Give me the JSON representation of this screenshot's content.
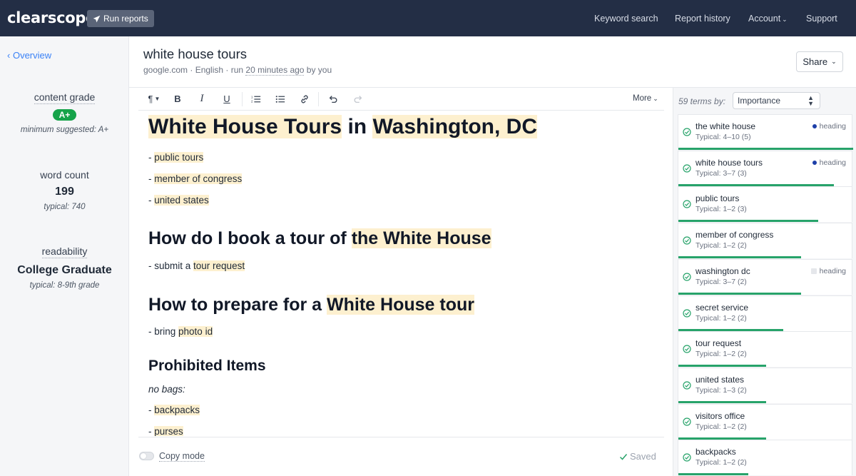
{
  "topbar": {
    "logo": "clearscope",
    "run_reports": "Run reports",
    "nav": {
      "keyword_search": "Keyword search",
      "report_history": "Report history",
      "account": "Account",
      "support": "Support"
    }
  },
  "sidebar": {
    "overview": "Overview",
    "content_grade_label": "content grade",
    "content_grade": "A+",
    "grade_min": "minimum suggested: A+",
    "word_count_label": "word count",
    "word_count": "199",
    "word_typical": "typical: 740",
    "readability_label": "readability",
    "readability": "College Graduate",
    "readability_typical": "typical: 8-9th grade"
  },
  "header": {
    "title": "white house tours",
    "meta_prefix": "google.com · English · run ",
    "meta_ago": "20 minutes ago",
    "meta_suffix": " by you",
    "share": "Share"
  },
  "toolbar": {
    "more": "More"
  },
  "document": {
    "h1_a": "White House Tours",
    "h1_b": " in ",
    "h1_c": "Washington, DC",
    "li1_prefix": "- ",
    "li1": "public tours",
    "li2_prefix": "- ",
    "li2": "member of congress",
    "li3_prefix": "- ",
    "li3": "united states",
    "h2a_a": "How do I book a tour of ",
    "h2a_b": "the White House",
    "p1_a": "- submit a ",
    "p1_b": "tour request",
    "h2b_a": "How to prepare for a ",
    "h2b_b": "White House tour",
    "p2_a": "- bring ",
    "p2_b": "photo id",
    "h3": "Prohibited Items",
    "p3": "no bags:",
    "li4_prefix": "- ",
    "li4": "backpacks",
    "li5_prefix": "- ",
    "li5": "purses"
  },
  "footer": {
    "copy_mode": "Copy mode",
    "saved": "Saved"
  },
  "terms_panel": {
    "count_label": "59 terms by:",
    "sort_value": "Importance",
    "terms": [
      {
        "name": "the white house",
        "typical": "Typical: 4–10 (5)",
        "tag": "heading",
        "tag_style": "dot",
        "progress": 1.0
      },
      {
        "name": "white house tours",
        "typical": "Typical: 3–7 (3)",
        "tag": "heading",
        "tag_style": "dot",
        "progress": 0.89
      },
      {
        "name": "public tours",
        "typical": "Typical: 1–2 (3)",
        "tag": "",
        "tag_style": "",
        "progress": 0.8
      },
      {
        "name": "member of congress",
        "typical": "Typical: 1–2 (2)",
        "tag": "",
        "tag_style": "",
        "progress": 0.7
      },
      {
        "name": "washington dc",
        "typical": "Typical: 3–7 (2)",
        "tag": "heading",
        "tag_style": "square",
        "progress": 0.7
      },
      {
        "name": "secret service",
        "typical": "Typical: 1–2 (2)",
        "tag": "",
        "tag_style": "",
        "progress": 0.6
      },
      {
        "name": "tour request",
        "typical": "Typical: 1–2 (2)",
        "tag": "",
        "tag_style": "",
        "progress": 0.5
      },
      {
        "name": "united states",
        "typical": "Typical: 1–3 (2)",
        "tag": "",
        "tag_style": "",
        "progress": 0.5
      },
      {
        "name": "visitors office",
        "typical": "Typical: 1–2 (2)",
        "tag": "",
        "tag_style": "",
        "progress": 0.5
      },
      {
        "name": "backpacks",
        "typical": "Typical: 1–2 (2)",
        "tag": "",
        "tag_style": "",
        "progress": 0.4
      }
    ]
  },
  "colors": {
    "topbar": "#232e45",
    "accent_green": "#27a36a",
    "highlight": "#fdf0cf",
    "link_blue": "#3b82f6",
    "heading_dot": "#1d3fa8"
  }
}
